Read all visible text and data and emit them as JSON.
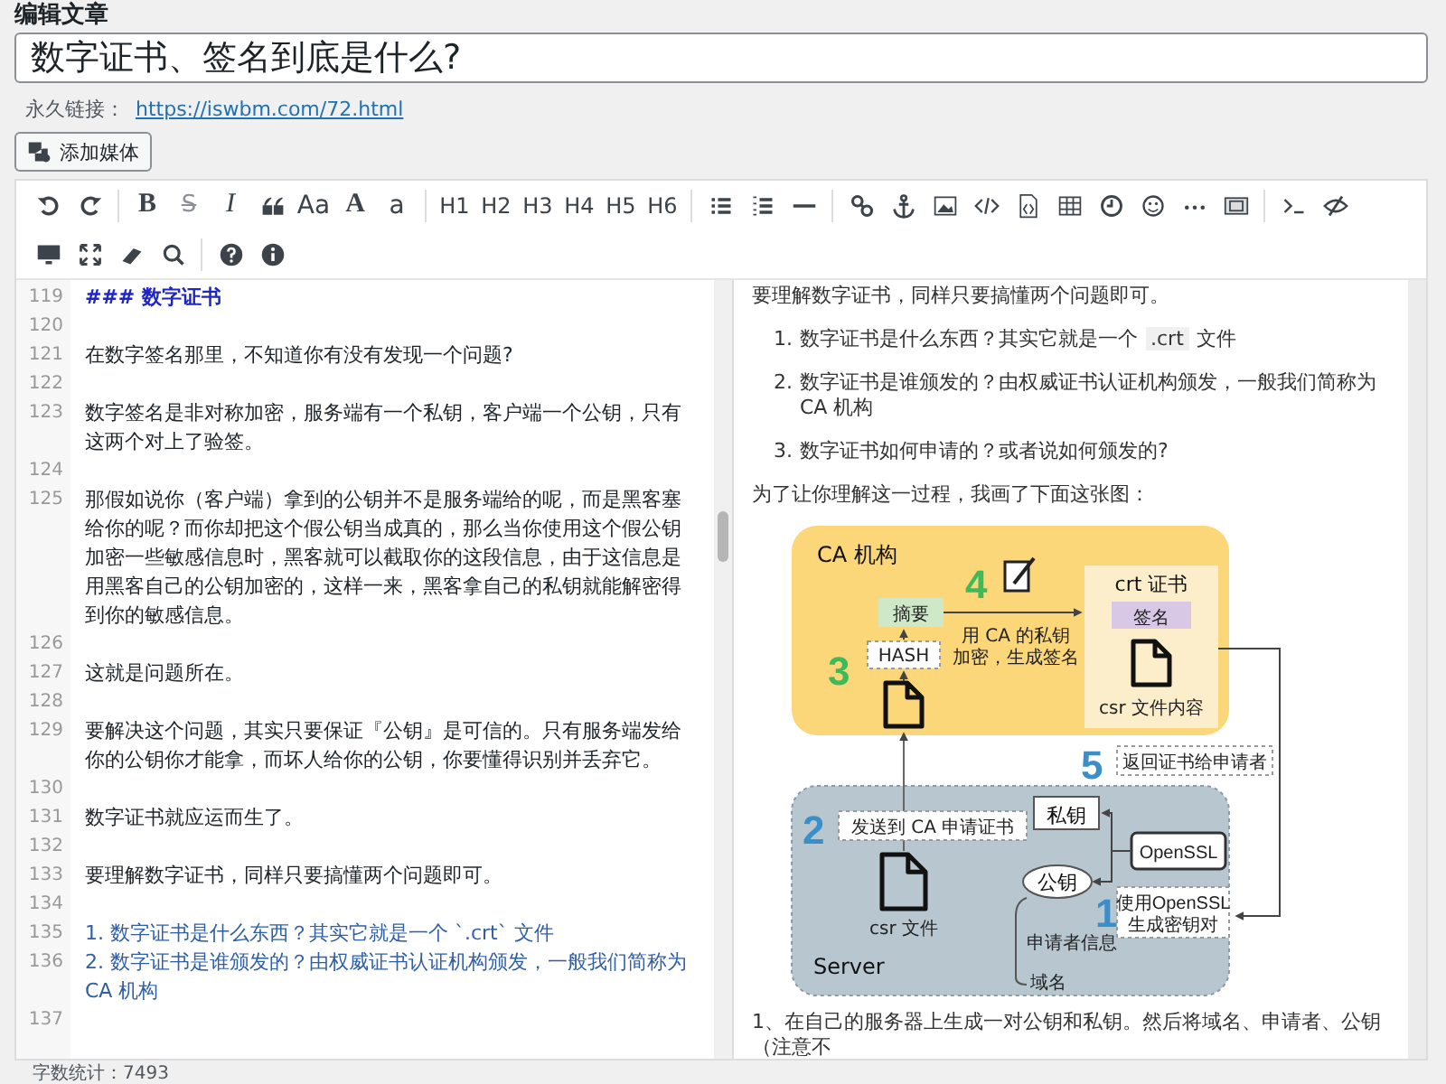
{
  "page_heading": "编辑文章",
  "title_field": {
    "value": "数字证书、签名到底是什么?"
  },
  "permalink": {
    "label": "永久链接：",
    "url": "https://iswbm.com/72.html"
  },
  "add_media_button": "添加媒体",
  "toolbar": {
    "labels": [
      {
        "label": "B",
        "kind": "bold"
      },
      {
        "label": "S",
        "kind": "strike"
      },
      {
        "label": "I",
        "kind": "italic"
      },
      {
        "label": "Aa",
        "kind": "sans"
      },
      {
        "label": "A",
        "kind": "serif"
      },
      {
        "label": "a",
        "kind": "sans"
      },
      {
        "label": "H1",
        "kind": "heading"
      },
      {
        "label": "H2",
        "kind": "heading"
      },
      {
        "label": "H3",
        "kind": "heading"
      },
      {
        "label": "H4",
        "kind": "heading"
      },
      {
        "label": "H5",
        "kind": "heading"
      },
      {
        "label": "H6",
        "kind": "heading"
      }
    ]
  },
  "editor": {
    "lines": [
      {
        "number": "119",
        "kind": "heading",
        "text": "### 数字证书"
      },
      {
        "number": "120"
      },
      {
        "number": "121",
        "kind": "text",
        "text": "在数字签名那里，不知道你有没有发现一个问题?"
      },
      {
        "number": "122"
      },
      {
        "number": "123",
        "kind": "text",
        "text": "数字签名是非对称加密，服务端有一个私钥，客户端一个公钥，只有这两个对上了验签。"
      },
      {
        "number": "124"
      },
      {
        "number": "125",
        "kind": "text",
        "text": "那假如说你（客户端）拿到的公钥并不是服务端给的呢，而是黑客塞给你的呢？而你却把这个假公钥当成真的，那么当你使用这个假公钥加密一些敏感信息时，黑客就可以截取你的这段信息，由于这信息是用黑客自己的公钥加密的，这样一来，黑客拿自己的私钥就能解密得到你的敏感信息。"
      },
      {
        "number": "126"
      },
      {
        "number": "127",
        "kind": "text",
        "text": "这就是问题所在。"
      },
      {
        "number": "128"
      },
      {
        "number": "129",
        "kind": "text",
        "text": "要解决这个问题，其实只要保证『公钥』是可信的。只有服务端发给你的公钥你才能拿，而坏人给你的公钥，你要懂得识别并丢弃它。"
      },
      {
        "number": "130"
      },
      {
        "number": "131",
        "kind": "text",
        "text": "数字证书就应运而生了。"
      },
      {
        "number": "132"
      },
      {
        "number": "133",
        "kind": "text",
        "text": "要理解数字证书，同样只要搞懂两个问题即可。"
      },
      {
        "number": "134"
      },
      {
        "number": "135",
        "kind": "list",
        "text": "1. 数字证书是什么东西？其实它就是一个 `.crt` 文件"
      },
      {
        "number": "136",
        "kind": "list",
        "text": "2. 数字证书是谁颁发的？由权威证书认证机构颁发，一般我们简称为 CA 机构"
      },
      {
        "number": "137"
      }
    ]
  },
  "preview": {
    "top_text": "要理解数字证书，同样只要搞懂两个问题即可。",
    "list": [
      {
        "number": "1.",
        "before": "数字证书是什么东西？其实它就是一个",
        "code": ".crt",
        "after": "文件"
      },
      {
        "number": "2.",
        "before": "数字证书是谁颁发的？由权威证书认证机构颁发，一般我们简称为 CA 机构"
      },
      {
        "number": "3.",
        "before": "数字证书如何申请的？或者说如何颁发的?"
      }
    ],
    "intro": "为了让你理解这一过程，我画了下面这张图：",
    "diagram": {
      "ca_label": "CA 机构",
      "crt_label": "crt 证书",
      "digest": "摘要",
      "hash": "HASH",
      "sign_note": [
        "用 CA 的私钥",
        "加密，生成签名"
      ],
      "signature": "签名",
      "csr_content": "csr 文件内容",
      "server_label": "Server",
      "send_note": "发送到 CA 申请证书",
      "private_key": "私钥",
      "public_key": "公钥",
      "openssl": "OpenSSL",
      "gen_note": [
        "使用OpenSSL",
        "生成密钥对"
      ],
      "applicant": "申请者信息",
      "domain": "域名",
      "csr_file": "csr 文件",
      "return_note": "返回证书给申请者",
      "steps": [
        "1",
        "2",
        "3",
        "4",
        "5"
      ]
    },
    "bottom_text": "1、在自己的服务器上生成一对公钥和私钥。然后将域名、申请者、公钥（注意不"
  },
  "status_bar": {
    "word_count": "字数统计：7493"
  }
}
